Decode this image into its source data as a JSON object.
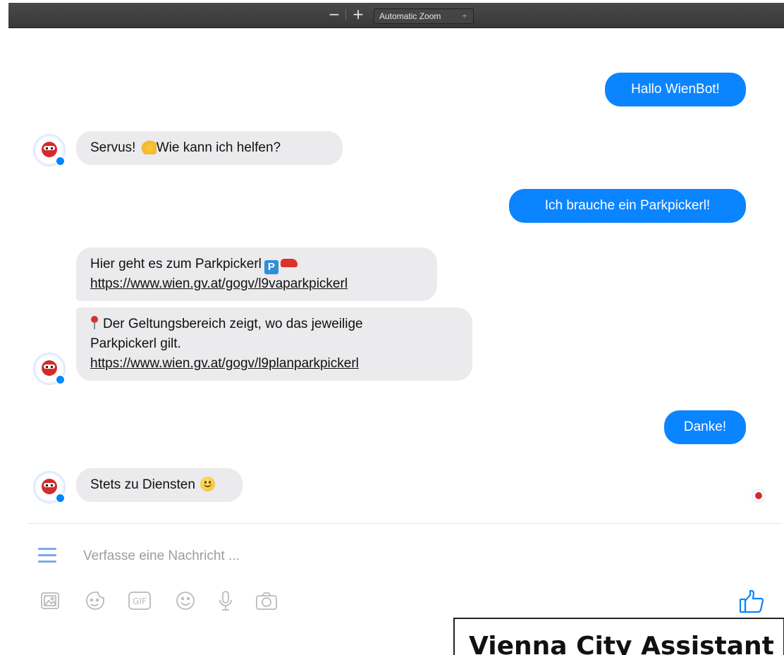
{
  "toolbar": {
    "zoom_out": "−",
    "zoom_in": "+",
    "zoom_level": "Automatic Zoom",
    "zoom_arrows": "÷"
  },
  "chat": {
    "messages": [
      {
        "from": "user",
        "text": "Hallo WienBot!"
      },
      {
        "from": "bot",
        "text_before": "Servus! ",
        "emoji": "waving-hand",
        "text_after": "Wie kann ich helfen?"
      },
      {
        "from": "user",
        "text": "Ich brauche ein Parkpickerl!"
      },
      {
        "from": "bot",
        "text": "Hier geht es zum Parkpickerl",
        "emojis": [
          "parking-sign",
          "car"
        ],
        "link": "https://www.wien.gv.at/gogv/l9vaparkpickerl"
      },
      {
        "from": "bot",
        "emoji": "round-pushpin",
        "line1": "Der Geltungsbereich zeigt, wo das jeweilige",
        "line2": "Parkpickerl gilt.",
        "link": "https://www.wien.gv.at/gogv/l9planparkpickerl"
      },
      {
        "from": "user",
        "text": "Danke!"
      },
      {
        "from": "bot",
        "text": "Stets zu Diensten",
        "emoji": "smiling-face"
      }
    ]
  },
  "composer": {
    "placeholder": "Verfasse eine Nachricht ...",
    "tools": [
      "photo-icon",
      "sticker-icon",
      "gif-icon",
      "emoji-icon",
      "microphone-icon",
      "camera-icon"
    ],
    "gif_label": "GIF",
    "like_icon": "thumbs-up-icon"
  },
  "caption": "Vienna City Assistant",
  "colors": {
    "accent": "#0b84ff",
    "incoming_bubble": "#ebeaec",
    "toolbar": "#3f3f3f"
  }
}
